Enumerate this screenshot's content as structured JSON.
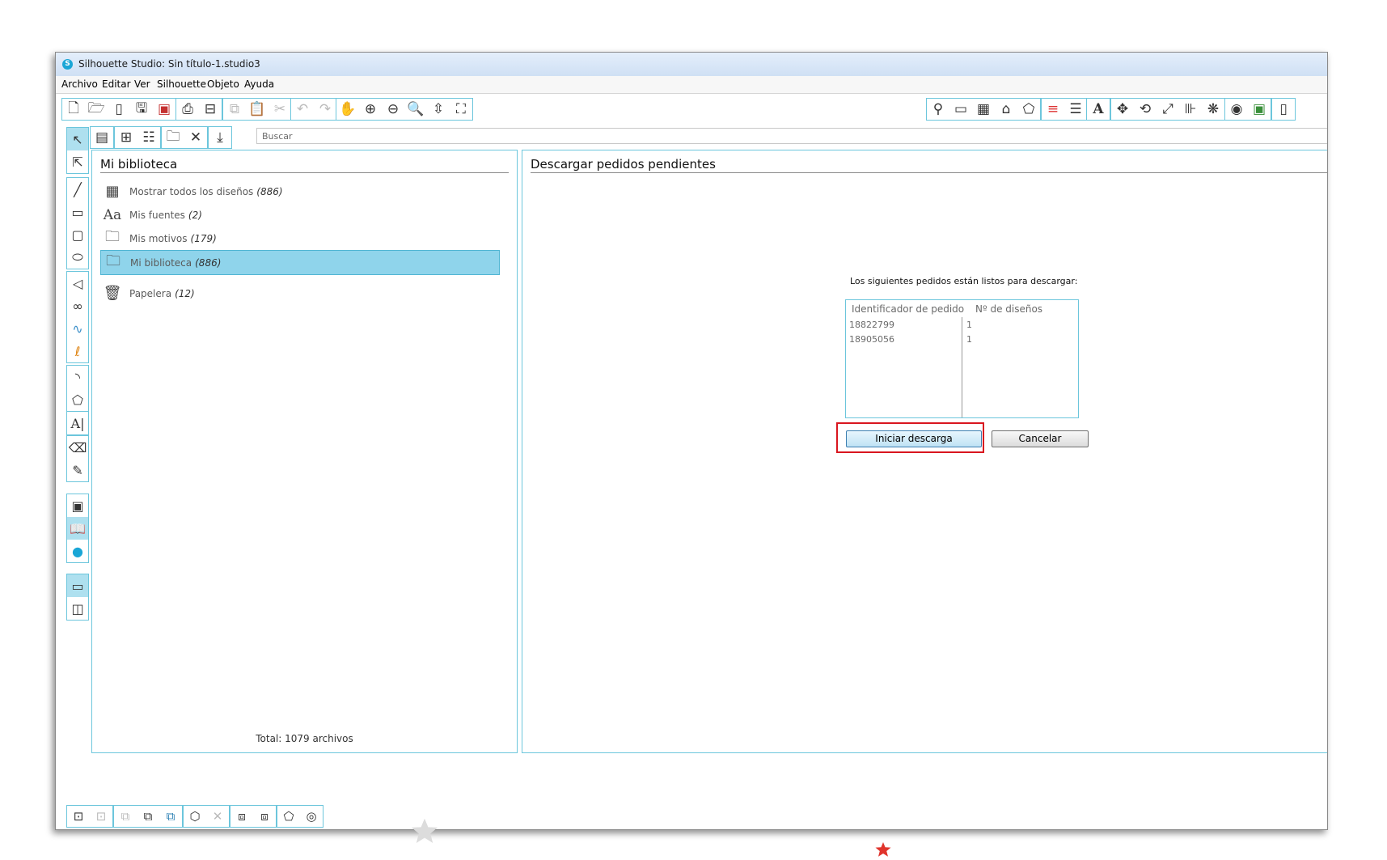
{
  "window": {
    "title": "Silhouette Studio: Sin título-1.studio3"
  },
  "menu": [
    "Archivo",
    "Editar",
    "Ver",
    "Silhouette",
    "Objeto",
    "Ayuda"
  ],
  "search": {
    "placeholder": "Buscar"
  },
  "library": {
    "title": "Mi biblioteca",
    "items": [
      {
        "label": "Mostrar todos los diseños",
        "count": "(886)",
        "icon": "grid-icon"
      },
      {
        "label": "Mis fuentes",
        "count": "(2)",
        "icon": "font-icon"
      },
      {
        "label": "Mis motivos",
        "count": "(179)",
        "icon": "folder-icon"
      },
      {
        "label": "Mi biblioteca",
        "count": "(886)",
        "icon": "folder-icon",
        "selected": true
      },
      {
        "label": "Papelera",
        "count": "(12)",
        "icon": "trash-icon"
      }
    ],
    "total": "Total: 1079 archivos"
  },
  "download": {
    "title": "Descargar pedidos pendientes",
    "intro": "Los siguientes pedidos están listos para descargar:",
    "columns": [
      "Identificador de pedido",
      "Nº de diseños"
    ],
    "rows": [
      {
        "id": "18822799",
        "designs": "1"
      },
      {
        "id": "18905056",
        "designs": "1"
      }
    ],
    "start_button": "Iniciar descarga",
    "cancel_button": "Cancelar"
  },
  "colors": {
    "accent": "#6cc6dc",
    "selection": "#8fd4eb",
    "highlight": "#d9161f"
  }
}
